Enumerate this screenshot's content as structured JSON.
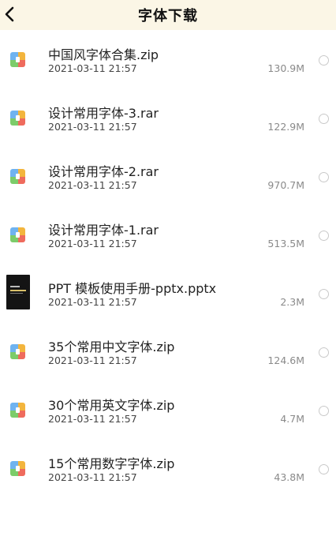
{
  "header": {
    "title": "字体下载",
    "back_icon": "chevron-left-icon"
  },
  "files": [
    {
      "name": "中国风字体合集.zip",
      "date": "2021-03-11 21:57",
      "size": "130.9M",
      "icon": "archive-icon"
    },
    {
      "name": "设计常用字体-3.rar",
      "date": "2021-03-11 21:57",
      "size": "122.9M",
      "icon": "archive-icon"
    },
    {
      "name": "设计常用字体-2.rar",
      "date": "2021-03-11 21:57",
      "size": "970.7M",
      "icon": "archive-icon"
    },
    {
      "name": "设计常用字体-1.rar",
      "date": "2021-03-11 21:57",
      "size": "513.5M",
      "icon": "archive-icon"
    },
    {
      "name": "PPT 模板使用手册-pptx.pptx",
      "date": "2021-03-11 21:57",
      "size": "2.3M",
      "icon": "pptx-thumbnail-icon"
    },
    {
      "name": "35个常用中文字体.zip",
      "date": "2021-03-11 21:57",
      "size": "124.6M",
      "icon": "archive-icon"
    },
    {
      "name": "30个常用英文字体.zip",
      "date": "2021-03-11 21:57",
      "size": "4.7M",
      "icon": "archive-icon"
    },
    {
      "name": "15个常用数字字体.zip",
      "date": "2021-03-11 21:57",
      "size": "43.8M",
      "icon": "archive-icon"
    }
  ],
  "colors": {
    "header_bg": "#fbf6e6",
    "archive_blue": "#6fb3f0",
    "archive_orange": "#f3b53d",
    "archive_green": "#7ccc6a",
    "archive_red": "#ef6b5d"
  }
}
